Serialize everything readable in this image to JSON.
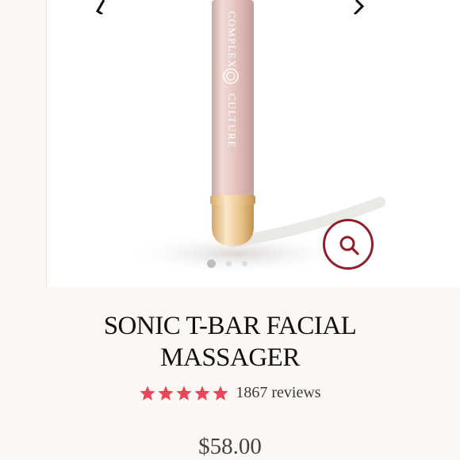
{
  "product": {
    "brand_line_1": "COMPLEX",
    "brand_line_2": "CULTURE",
    "title_line_1": "SONIC T-BAR FACIAL",
    "title_line_2": "MASSAGER",
    "rating_value": 5,
    "rating_max": 5,
    "reviews_label": "1867 reviews",
    "price": "$58.00"
  },
  "gallery": {
    "slide_count": 3,
    "active_slide": 1
  },
  "icons": {
    "zoom": "magnifier-icon",
    "prev": "chevron-left-icon",
    "next": "chevron-right-icon",
    "star": "star-icon"
  },
  "colors": {
    "accent": "#8f1f2a",
    "star": "#e8465b",
    "device_body": "#e7c8c2",
    "device_tip": "#e9c99a",
    "background": "#fbf8f4"
  }
}
